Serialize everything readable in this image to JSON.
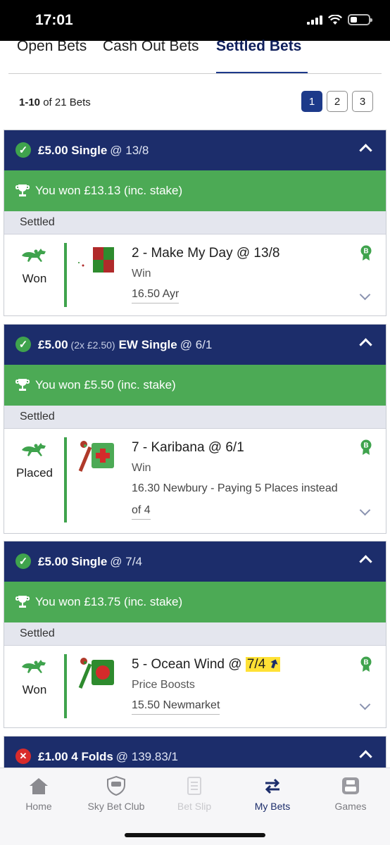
{
  "status_bar": {
    "time": "17:01"
  },
  "tabs": [
    {
      "label": "Open Bets"
    },
    {
      "label": "Cash Out Bets"
    },
    {
      "label": "Settled Bets"
    }
  ],
  "pager": {
    "range": "1-10",
    "summary_suffix": "of 21 Bets",
    "pages": [
      "1",
      "2",
      "3"
    ],
    "active_page": "1"
  },
  "bets": [
    {
      "status": "won",
      "stake": "£5.00",
      "stake_detail": "",
      "bet_type": "Single",
      "odds": "@ 13/8",
      "banner": "You won £13.13 (inc. stake)",
      "settled_label": "Settled",
      "selection": {
        "result": "Won",
        "name": "2 - Make My Day @ 13/8",
        "market": "Win",
        "event": "16.50 Ayr",
        "badge": "B"
      }
    },
    {
      "status": "won",
      "stake": "£5.00",
      "stake_detail": "(2x £2.50)",
      "bet_type": "EW Single",
      "odds": "@ 6/1",
      "banner": "You won £5.50 (inc. stake)",
      "settled_label": "Settled",
      "selection": {
        "result": "Placed",
        "name": "7 - Karibana @ 6/1",
        "market": "Win",
        "event_line1": "16.30 Newbury - Paying 5 Places instead",
        "event_line2": "of 4",
        "badge": "B"
      }
    },
    {
      "status": "won",
      "stake": "£5.00",
      "stake_detail": "",
      "bet_type": "Single",
      "odds": "@ 7/4",
      "banner": "You won £13.75 (inc. stake)",
      "settled_label": "Settled",
      "selection": {
        "result": "Won",
        "name_prefix": "5 - Ocean Wind @ ",
        "boosted_odds": "7/4",
        "market": "Price Boosts",
        "event": "15.50 Newmarket",
        "badge": "B"
      }
    },
    {
      "status": "lost",
      "stake": "£1.00",
      "bet_type": "4 Folds",
      "odds": "@ 139.83/1"
    }
  ],
  "bottom_nav": [
    {
      "label": "Home",
      "icon": "home-icon"
    },
    {
      "label": "Sky Bet Club",
      "icon": "sky-bet-club-icon"
    },
    {
      "label": "Bet Slip",
      "icon": "bet-slip-icon"
    },
    {
      "label": "My Bets",
      "icon": "my-bets-icon"
    },
    {
      "label": "Games",
      "icon": "games-icon"
    }
  ],
  "colors": {
    "header_navy": "#1c2d6b",
    "won_green": "#4caa55",
    "lost_red": "#d92b2b",
    "boost_yellow": "#ffe135"
  }
}
